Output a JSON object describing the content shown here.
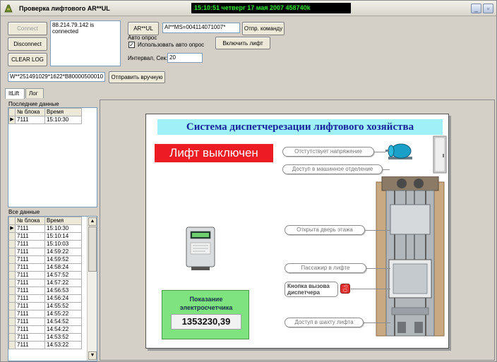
{
  "window": {
    "title": "Проверка лифтового AR**UL",
    "clock": "15:10:51 четверг 17 мая 2007 458740k"
  },
  "toolbar": {
    "connect_label": "Connect",
    "disconnect_label": "Disconnect",
    "clear_log_label": "CLEAR LOG",
    "connection_log": "88.214.79.142 is connected",
    "arul_label": "AR**UL",
    "command_value": "AI**MS=004114071007*",
    "send_command_label": "Отпр. команду",
    "auto_poll_group": "Авто опрос",
    "auto_poll_checkbox_label": "Использовать авто опрос",
    "interval_label": "Интервал, Сек:",
    "interval_value": "20",
    "enable_lift_label": "Включить лифт",
    "manual_value": "W**251491029*1622*B80000500010",
    "send_manual_label": "Отправить вручную"
  },
  "tabs": [
    {
      "label": "ItLift",
      "active": true
    },
    {
      "label": "Лог",
      "active": false
    }
  ],
  "last_data": {
    "caption": "Последние данные",
    "columns": [
      "№ блока",
      "Время"
    ],
    "rows": [
      [
        "7111",
        "15:10:30"
      ]
    ]
  },
  "all_data": {
    "caption": "Все данные",
    "columns": [
      "№ блока",
      "Время"
    ],
    "rows": [
      [
        "7111",
        "15:10:30"
      ],
      [
        "7111",
        "15:10:14"
      ],
      [
        "7111",
        "15:10:03"
      ],
      [
        "7111",
        "14:59:22"
      ],
      [
        "7111",
        "14:59:52"
      ],
      [
        "7111",
        "14:58:24"
      ],
      [
        "7111",
        "14:57:52"
      ],
      [
        "7111",
        "14:57:22"
      ],
      [
        "7111",
        "14:56:53"
      ],
      [
        "7111",
        "14:56:24"
      ],
      [
        "7111",
        "14:55:52"
      ],
      [
        "7111",
        "14:55:22"
      ],
      [
        "7111",
        "14:54:52"
      ],
      [
        "7111",
        "14:54:22"
      ],
      [
        "7111",
        "14:53:52"
      ],
      [
        "7111",
        "14:53:22"
      ]
    ]
  },
  "panel": {
    "title": "Система диспетчерезации лифтового хозяйства",
    "lift_status": "Лифт выключен",
    "no_power": "Отстутствует напряжение",
    "machine_room": "Доступ в машинное отделение",
    "door_open": "Открыта дверь этажа",
    "passenger": "Пассажир в лифте",
    "call_button_label": "Кнопка вызова диспетчера",
    "shaft_access": "Доступ в шахту лифта",
    "meter_title": "Показание электросчетчика",
    "meter_value": "1353230,39"
  },
  "colors": {
    "status_red": "#ed1c24",
    "title_cyan": "#9ff0f7",
    "title_blue": "#15259a",
    "meter_green": "#7fe37f",
    "clock_green": "#2fe82f"
  }
}
